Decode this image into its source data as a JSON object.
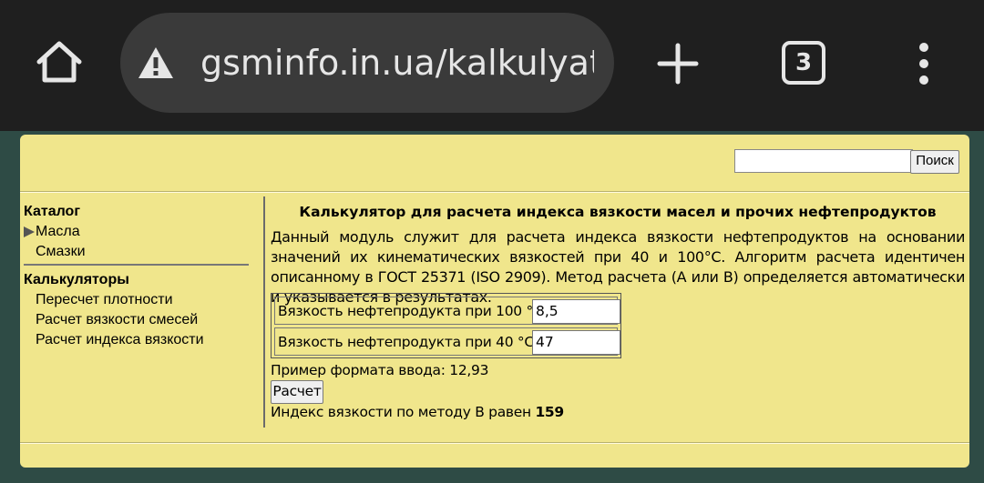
{
  "browser": {
    "url": "gsminfo.in.ua/kalkulyator",
    "tab_count": "3",
    "chrome_color": "#1f1f1f"
  },
  "header": {
    "search_placeholder": "",
    "search_button": "Поиск"
  },
  "sidebar": {
    "catalog_heading": "Каталог",
    "catalog_items": [
      {
        "label": "Масла",
        "active": true
      },
      {
        "label": "Смазки",
        "active": false
      }
    ],
    "calculators_heading": "Калькуляторы",
    "calculator_items": [
      {
        "label": "Пересчет плотности"
      },
      {
        "label": "Расчет вязкости смесей"
      },
      {
        "label": "Расчет индекса вязкости"
      }
    ]
  },
  "main": {
    "title": "Калькулятор для расчета индекса вязкости масел и прочих нефтепродуктов",
    "description": "Данный модуль служит для расчета индекса вязкости нефтепродуктов на основании значений их кинематических вязкостей при 40 и 100°С. Алгоритм расчета идентичен описанному в ГОСТ 25371 (ISO 2909). Метод расчета (А или В) определяется автоматически и указывается в результатах.",
    "fields": [
      {
        "label": "Вязкость нефтепродукта при 100 °С:",
        "value": "8,5"
      },
      {
        "label": "Вязкость нефтепродукта при 40 °С:",
        "value": "47"
      }
    ],
    "example": "Пример формата ввода: 12,93",
    "calc_button": "Расчет",
    "result_text": "Индекс вязкости по методу В равен",
    "result_value": "159"
  },
  "colors": {
    "page_bg": "#f0e68c",
    "outer_bg": "#2e4b45"
  }
}
